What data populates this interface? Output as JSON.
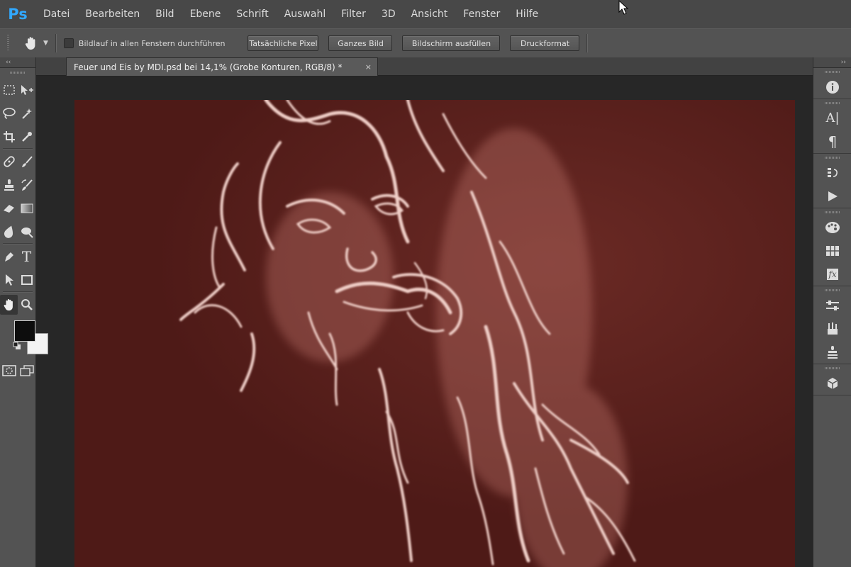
{
  "app": {
    "logo": "Ps"
  },
  "menu": {
    "items": [
      "Datei",
      "Bearbeiten",
      "Bild",
      "Ebene",
      "Schrift",
      "Auswahl",
      "Filter",
      "3D",
      "Ansicht",
      "Fenster",
      "Hilfe"
    ]
  },
  "options_bar": {
    "active_tool": "hand-icon",
    "scroll_all_windows_label": "Bildlauf in allen Fenstern durchführen",
    "scroll_all_windows_checked": false,
    "buttons": [
      "Tatsächliche Pixel",
      "Ganzes Bild",
      "Bildschirm ausfüllen",
      "Druckformat"
    ]
  },
  "document": {
    "tab_title": "Feuer und Eis by MDI.psd bei 14,1% (Grobe Konturen, RGB/8) *",
    "close_glyph": "×",
    "canvas_background": "#4e1a17",
    "line_color": "#f0cfc8"
  },
  "toolbar": {
    "collapse_glyph": "‹‹",
    "tools": [
      [
        "marquee-icon",
        "move-icon"
      ],
      [
        "lasso-icon",
        "magic-wand-icon"
      ],
      [
        "crop-icon",
        "eyedropper-icon"
      ],
      [
        "healing-brush-icon",
        "brush-icon"
      ],
      [
        "clone-stamp-icon",
        "history-brush-icon"
      ],
      [
        "eraser-icon",
        "gradient-icon"
      ],
      [
        "blur-icon",
        "dodge-icon"
      ],
      [
        "pen-icon",
        "type-icon"
      ],
      [
        "path-selection-icon",
        "rectangle-icon"
      ],
      [
        "hand-icon",
        "zoom-icon"
      ]
    ],
    "type_glyph": "T",
    "active_tool": "hand-icon",
    "foreground_color": "#0d0d0d",
    "background_color": "#f3f3f3"
  },
  "right_panels": {
    "collapse_glyph": "››",
    "groups": [
      [
        "info-icon"
      ],
      [
        "character-icon",
        "paragraph-icon"
      ],
      [
        "history-icon",
        "actions-icon"
      ],
      [
        "color-icon",
        "swatches-icon",
        "styles-icon"
      ],
      [
        "adjustments-icon",
        "brushes-icon",
        "clone-source-icon"
      ],
      [
        "3d-icon"
      ]
    ],
    "character_glyph": "A|",
    "paragraph_glyph": "¶",
    "styles_glyph": "fx"
  }
}
